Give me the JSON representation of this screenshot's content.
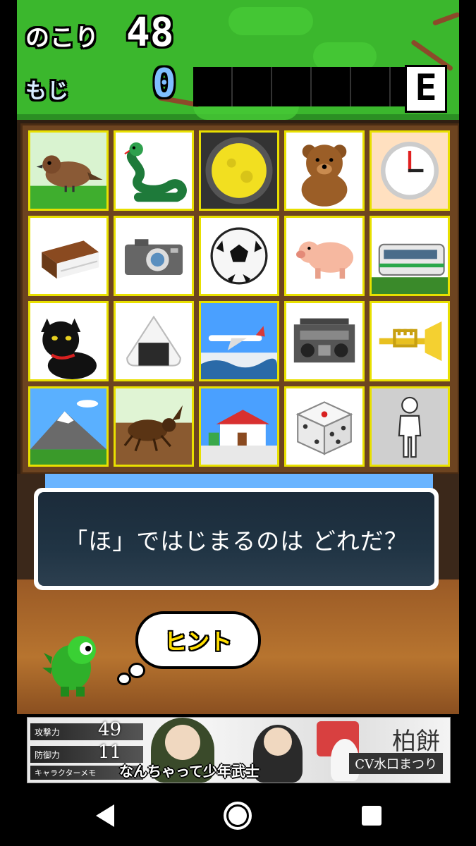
{
  "status": {
    "remaining_label": "のこり",
    "remaining_value": "48",
    "letters_label": "もじ",
    "letters_value": "0",
    "answer_slots": 6,
    "grade": "E"
  },
  "board": {
    "tiles": [
      {
        "name": "sparrow"
      },
      {
        "name": "snake"
      },
      {
        "name": "moon"
      },
      {
        "name": "bear"
      },
      {
        "name": "clock"
      },
      {
        "name": "book"
      },
      {
        "name": "camera"
      },
      {
        "name": "soccer-ball"
      },
      {
        "name": "pig"
      },
      {
        "name": "train"
      },
      {
        "name": "black-cat"
      },
      {
        "name": "rice-ball"
      },
      {
        "name": "airplane"
      },
      {
        "name": "radio-cassette"
      },
      {
        "name": "trumpet"
      },
      {
        "name": "mountain"
      },
      {
        "name": "beetle"
      },
      {
        "name": "house"
      },
      {
        "name": "dice"
      },
      {
        "name": "person"
      }
    ]
  },
  "question": "「ほ」ではじまるのは どれだ？",
  "hint_label": "ヒント",
  "ad": {
    "stat1_label": "攻撃力",
    "stat1_value": "49",
    "stat2_label": "防御力",
    "stat2_value": "11",
    "stat3_label": "キャラクターメモ",
    "tagline": "なんちゃって少年武士",
    "character_name": "柏餅",
    "cv": "CV水口まつり"
  },
  "colors": {
    "grass": "#3bb72d",
    "tile_border": "#e8e000",
    "board": "#6d4420",
    "hint_text": "#ffde00"
  }
}
